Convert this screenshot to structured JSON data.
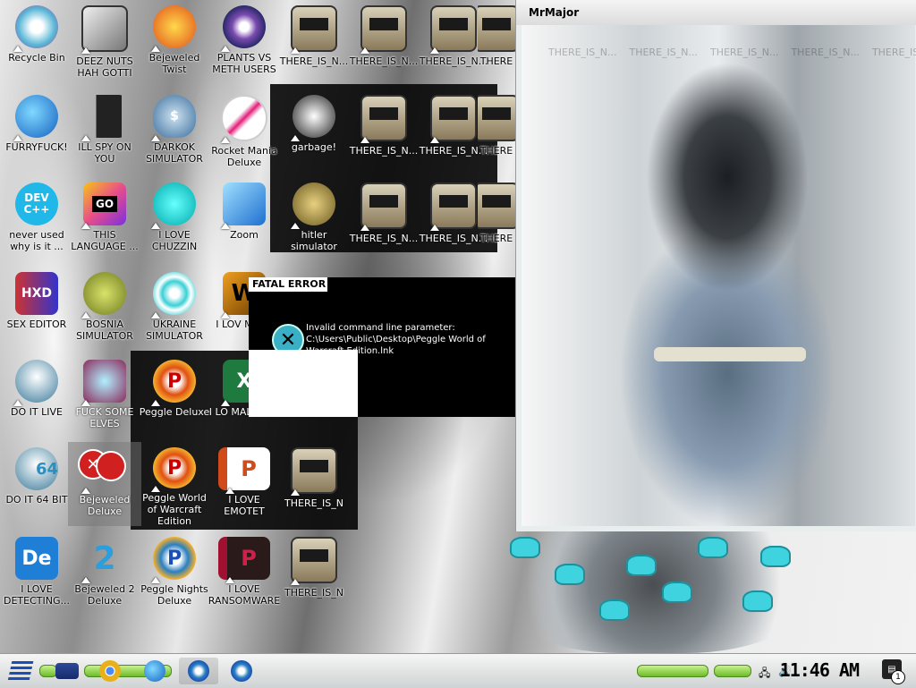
{
  "desktop": {
    "icons_col1": [
      "Recycle Bin",
      "FURRYFUCK!",
      "never used why is it ...",
      "SEX EDITOR",
      "DO IT LIVE",
      "DO IT 64 BIT",
      "I LOVE DETECTING..."
    ],
    "icons_col2": [
      "DEEZ NUTS HAH GOTTI",
      "ILL SPY ON YOU",
      "THIS LANGUAGE ...",
      "BOSNIA SIMULATOR",
      "FUCK SOME ELVES",
      "Bejeweled Deluxe",
      "Bejeweled 2 Deluxe"
    ],
    "icons_col3": [
      "Bejeweled Twist",
      "DARKOK SIMULATOR",
      "I LOVE CHUZZIN",
      "UKRAINE SIMULATOR",
      "Peggle Deluxe",
      "Peggle World of Warcraft Edition",
      "Peggle Nights Deluxe"
    ],
    "icons_col4": [
      "PLANTS VS METH USERS",
      "Rocket Mania Deluxe",
      "Zoom",
      "I LOV MALD",
      "I LO MALSPA...",
      "I LOVE EMOTET",
      "I LOVE RANSOMWARE"
    ],
    "icons_col5": [
      "THERE_IS_N...",
      "garbage!",
      "hitler simulator",
      "THERE_IS_N",
      "THERE_IS_N"
    ],
    "icons_col6": [
      "THERE_IS_N...",
      "THERE_IS_N...",
      "THERE_IS_N..."
    ],
    "icons_col7": [
      "THERE_IS_N...",
      "THERE_IS_N...",
      "THERE_IS_N..."
    ],
    "icons_col8": [
      "THERE",
      "THERE",
      "THERE"
    ],
    "dev_text": "DEV\nC++",
    "go_text": "GO",
    "hxd_text": "HXD",
    "de_text": "De",
    "b64_text": "64"
  },
  "error_window": {
    "title": "FATAL ERROR",
    "message": "Invalid command line parameter: C:\\Users\\Public\\Desktop\\Peggle World of Warcraft Edition.lnk",
    "icon": "x-icon"
  },
  "mrmajor_window": {
    "title": "MrMajor",
    "ghost_labels": [
      "THERE_IS_N...",
      "THERE_IS_N...",
      "THERE_IS_N...",
      "THERE_IS_N...",
      "THERE_IS_N..."
    ]
  },
  "taskbar": {
    "clock": "11:46 AM",
    "notification_count": "1",
    "tray_icons": [
      "network-icon",
      "volume-icon"
    ]
  },
  "colors": {
    "accent_blue": "#1a4fb5",
    "green_bar": "#6dbb2a",
    "error_icon": "#3ab0c6",
    "virus_spike": "#3fd3df"
  }
}
